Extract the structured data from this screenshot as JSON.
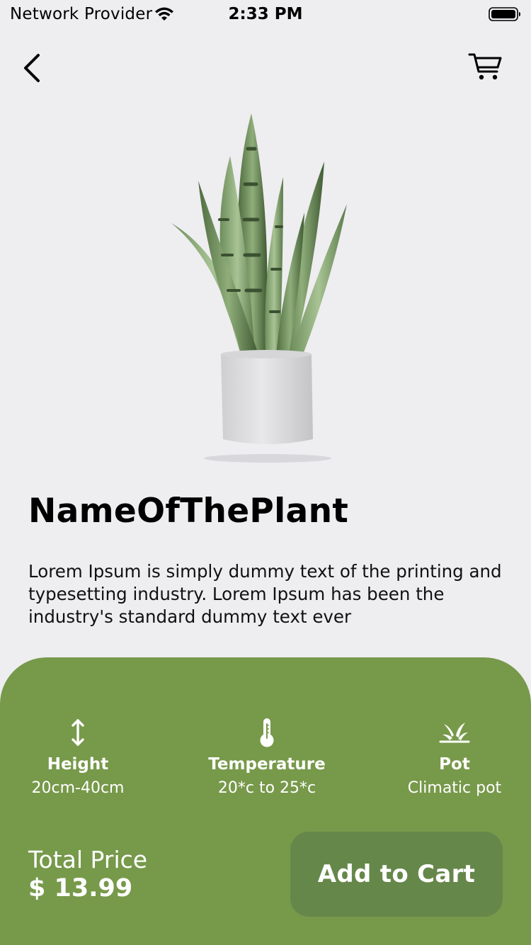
{
  "status_bar": {
    "carrier": "Network Provider",
    "time": "2:33 PM",
    "icons": [
      "wifi-icon",
      "battery-icon"
    ]
  },
  "nav": {
    "back_icon": "chevron-left-icon",
    "cart_icon": "shopping-cart-icon"
  },
  "product": {
    "image": "snake-plant-in-white-pot",
    "name": "NameOfThePlant",
    "description": "Lorem Ipsum is simply dummy text of the printing and typesetting industry. Lorem Ipsum has been the industry's standard dummy text ever"
  },
  "specs": [
    {
      "icon": "vertical-arrows-icon",
      "label": "Height",
      "value": "20cm-40cm"
    },
    {
      "icon": "thermometer-icon",
      "label": "Temperature",
      "value": "20*c to 25*c"
    },
    {
      "icon": "plant-pot-icon",
      "label": "Pot",
      "value": "Climatic pot"
    }
  ],
  "checkout": {
    "total_label": "Total Price",
    "price": "$ 13.99",
    "button_label": "Add to Cart"
  },
  "colors": {
    "background": "#eeedf0",
    "panel": "#77994a",
    "button": "#66874a",
    "text_on_panel": "#ffffff"
  }
}
